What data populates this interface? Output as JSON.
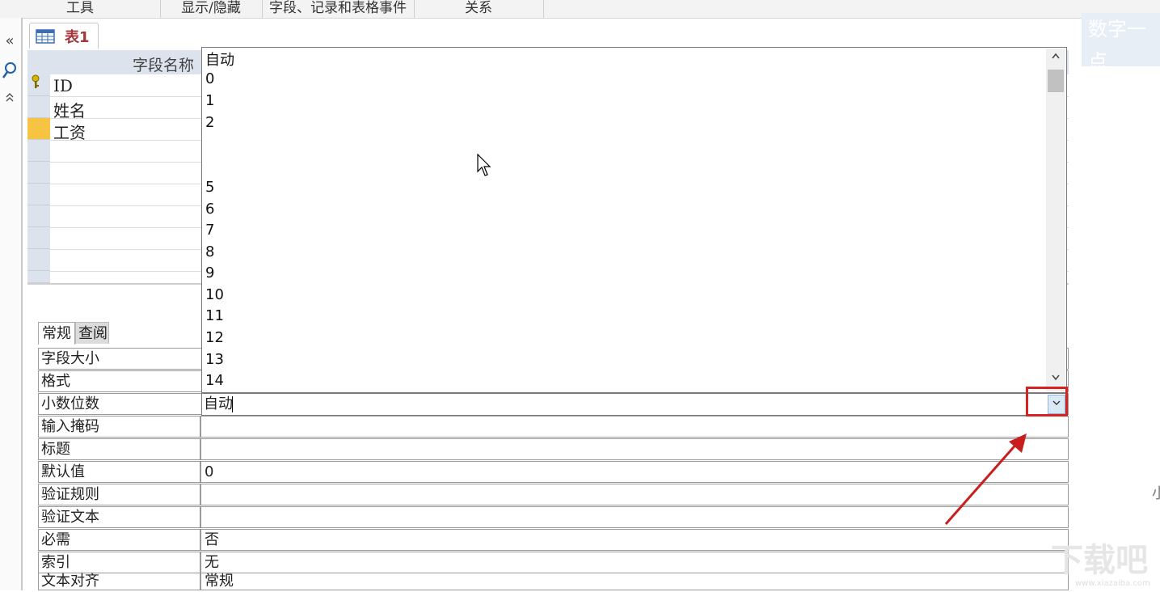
{
  "ribbon": {
    "groups": [
      "工具",
      "显示/隐藏",
      "字段、记录和表格事件",
      "关系"
    ]
  },
  "watermark_top": "数字一点",
  "nav": {
    "collapse_icon": "«",
    "search_icon": "search-icon",
    "expand_icon": "»"
  },
  "tab": {
    "label": "表1"
  },
  "grid": {
    "header": "字段名称",
    "fields": [
      "ID",
      "姓名",
      "工资"
    ]
  },
  "properties": {
    "tabs": [
      "常规",
      "查阅"
    ],
    "rows": [
      {
        "label": "字段大小",
        "value": ""
      },
      {
        "label": "格式",
        "value": ""
      },
      {
        "label": "小数位数",
        "value": "自动"
      },
      {
        "label": "输入掩码",
        "value": ""
      },
      {
        "label": "标题",
        "value": ""
      },
      {
        "label": "默认值",
        "value": "0"
      },
      {
        "label": "验证规则",
        "value": ""
      },
      {
        "label": "验证文本",
        "value": ""
      },
      {
        "label": "必需",
        "value": "否"
      },
      {
        "label": "索引",
        "value": "无"
      },
      {
        "label": "文本对齐",
        "value": "常规"
      }
    ]
  },
  "dropdown": {
    "options": [
      "自动",
      "0",
      "1",
      "2",
      "5",
      "6",
      "7",
      "8",
      "9",
      "10",
      "11",
      "12",
      "13",
      "14"
    ]
  },
  "combo": {
    "value": "自动",
    "button_icon": "chevron-down-icon"
  },
  "watermark_bottom": {
    "big": "下载吧",
    "small": "www.xiazaiba.com"
  },
  "edge_glyph": "小",
  "colors": {
    "highlight_red": "#d62222",
    "tab_text": "#a4373a",
    "header_bg": "#dde3ec"
  }
}
